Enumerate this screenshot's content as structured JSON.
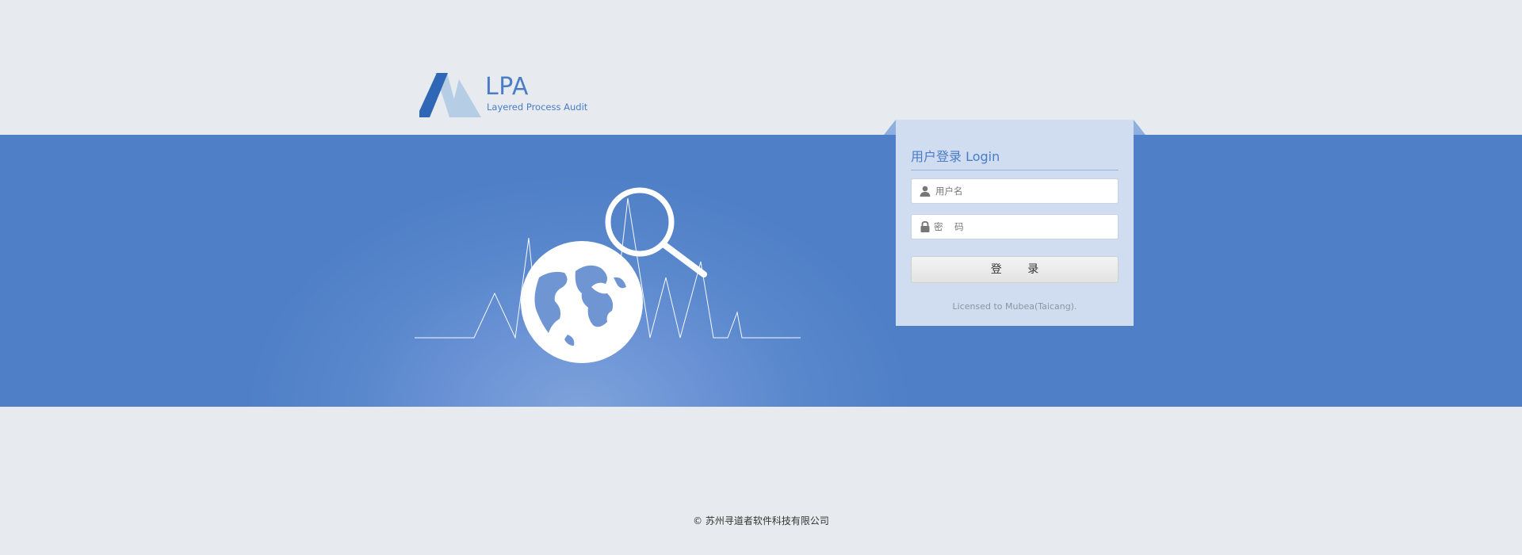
{
  "logo": {
    "title": "LPA",
    "subtitle": "Layered Process Audit",
    "colors": {
      "dark": "#2f66b6",
      "light": "#b6cde6"
    }
  },
  "illustration": {
    "description_icons": [
      "globe-icon",
      "magnifier-icon",
      "pulse-line"
    ]
  },
  "login": {
    "title": "用户登录 Login",
    "username": {
      "value": "",
      "placeholder": "用户名",
      "icon": "user-icon"
    },
    "password": {
      "value": "",
      "placeholder": "密    码",
      "icon": "lock-icon"
    },
    "submit_label": "登 录",
    "license": "Licensed to Mubea(Taicang)."
  },
  "footer": {
    "copyright": "© 苏州寻道者软件科技有限公司"
  },
  "colors": {
    "band": "#5282c9",
    "panel": "#d0ddf0",
    "accent": "#4a7cc8",
    "background": "#e7ebef"
  }
}
